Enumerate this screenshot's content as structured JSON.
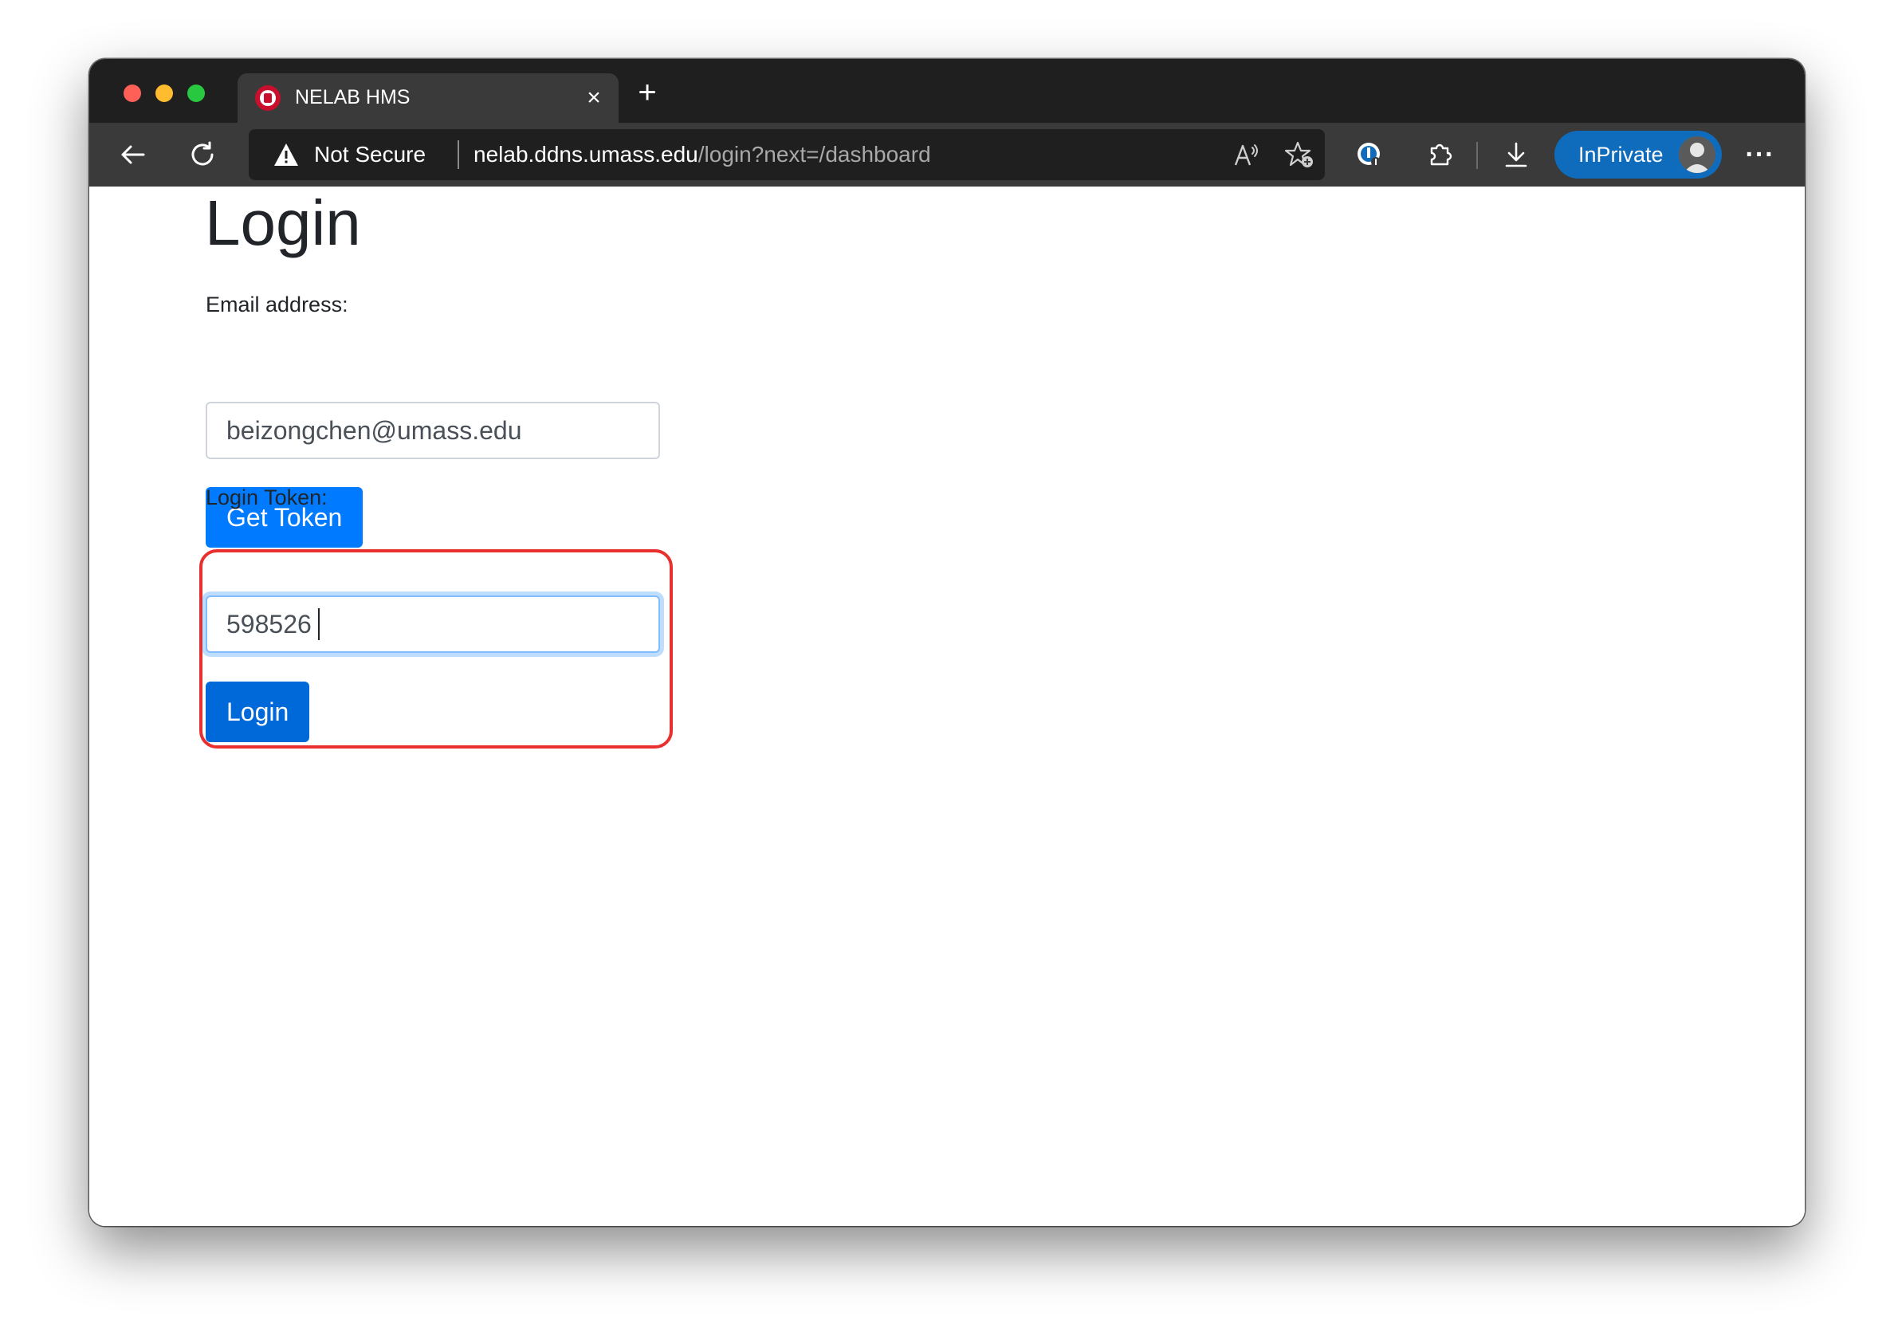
{
  "browser": {
    "tab": {
      "title": "NELAB HMS",
      "close_glyph": "×",
      "favicon": "umass-seal-icon"
    },
    "new_tab_glyph": "+",
    "address_bar": {
      "security_label": "Not Secure",
      "url_host": "nelab.ddns.umass.edu",
      "url_path": "/login?next=/dashboard"
    },
    "inprivate_label": "InPrivate",
    "more_glyph": "···"
  },
  "page": {
    "title": "Login",
    "email": {
      "label": "Email address:",
      "value": "beizongchen@umass.edu"
    },
    "get_token_button": "Get Token",
    "token": {
      "label": "Login Token:",
      "value": "598526"
    },
    "login_button": "Login"
  },
  "colors": {
    "primary_button": "#007bff",
    "annotation_outline": "#e8312f",
    "inprivate_pill": "#0f6cbd"
  }
}
